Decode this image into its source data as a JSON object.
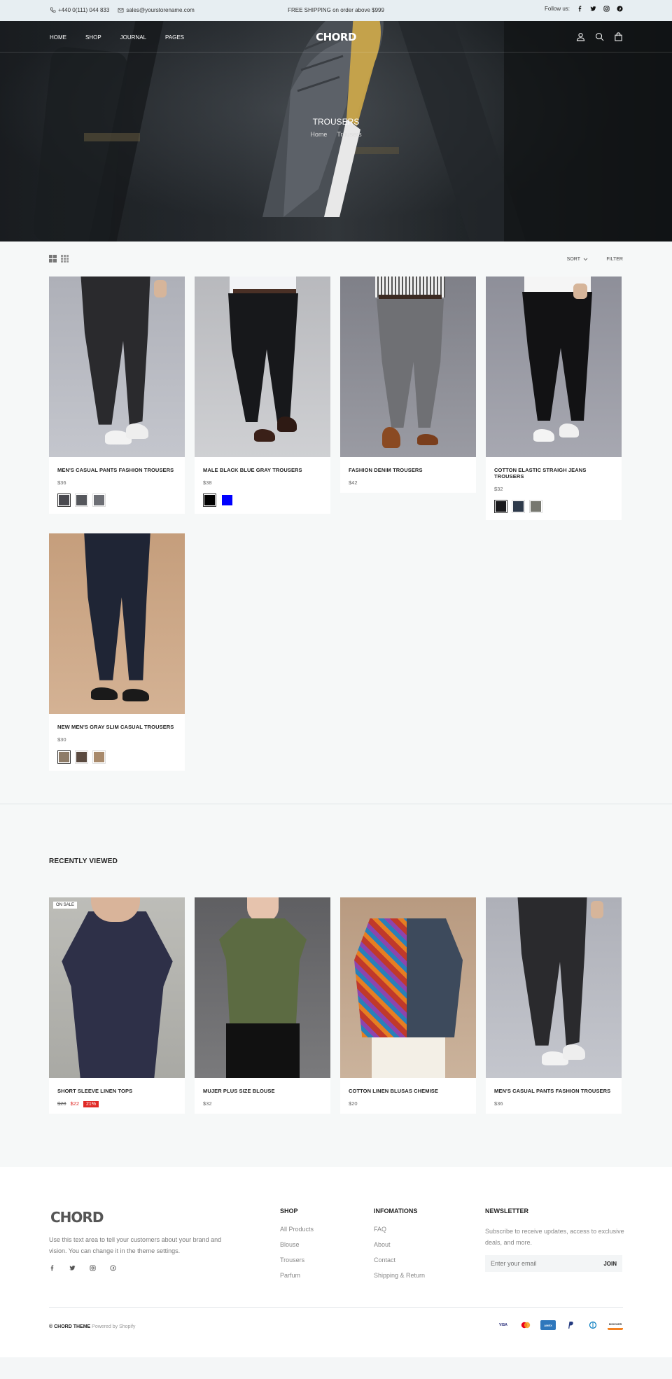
{
  "topbar": {
    "phone": "+440 0(111) 044 833",
    "email": "sales@yourstorename.com",
    "shipping": "FREE SHIPPING on order above $999",
    "follow": "Follow us:"
  },
  "nav": {
    "links": [
      "HOME",
      "SHOP",
      "JOURNAL",
      "PAGES"
    ],
    "logo": "CHORD"
  },
  "hero": {
    "title": "TROUSERS",
    "breadcrumb": [
      "Home",
      "Trousers"
    ]
  },
  "toolbar": {
    "sort": "SORT",
    "filter": "FILTER"
  },
  "products": [
    {
      "name": "MEN'S CASUAL PANTS FASHION TROUSERS",
      "price": "$36"
    },
    {
      "name": "MALE BLACK BLUE GRAY TROUSERS",
      "price": "$38"
    },
    {
      "name": "FASHION DENIM TROUSERS",
      "price": "$42"
    },
    {
      "name": "COTTON ELASTIC STRAIGH JEANS TROUSERS",
      "price": "$32"
    },
    {
      "name": "NEW MEN'S GRAY SLIM CASUAL TROUSERS",
      "price": "$30"
    }
  ],
  "recently_viewed": {
    "title": "RECENTLY VIEWED",
    "items": [
      {
        "name": "SHORT SLEEVE LINEN TOPS",
        "old_price": "$28",
        "price": "$22",
        "discount": "21%",
        "badge": "ON SALE"
      },
      {
        "name": "MUJER PLUS SIZE BLOUSE",
        "price": "$32"
      },
      {
        "name": "COTTON LINEN BLUSAS CHEMISE",
        "price": "$20"
      },
      {
        "name": "MEN'S CASUAL PANTS FASHION TROUSERS",
        "price": "$36"
      }
    ]
  },
  "footer": {
    "logo": "CHORD",
    "description": "Use this text area to tell your customers about your brand and vision. You can change it in the theme settings.",
    "shop": {
      "title": "SHOP",
      "links": [
        "All Products",
        "Blouse",
        "Trousers",
        "Parfum"
      ]
    },
    "info": {
      "title": "INFOMATIONS",
      "links": [
        "FAQ",
        "About",
        "Contact",
        "Shipping & Return"
      ]
    },
    "newsletter": {
      "title": "NEWSLETTER",
      "text": "Subscribe to receive updates, access to exclusive deals, and more.",
      "placeholder": "Enter your email",
      "button": "JOIN"
    },
    "copyright": "© CHORD THEME",
    "powered": "Powered by Shopify",
    "payments": [
      "VISA",
      "mastercard",
      "AMEX",
      "PayPal",
      "Diners",
      "DISCOVER"
    ]
  },
  "colors": {
    "topbar_bg": "#e7eef2",
    "sale_red": "#e02b27",
    "swatch_blue": "#0000ff"
  }
}
